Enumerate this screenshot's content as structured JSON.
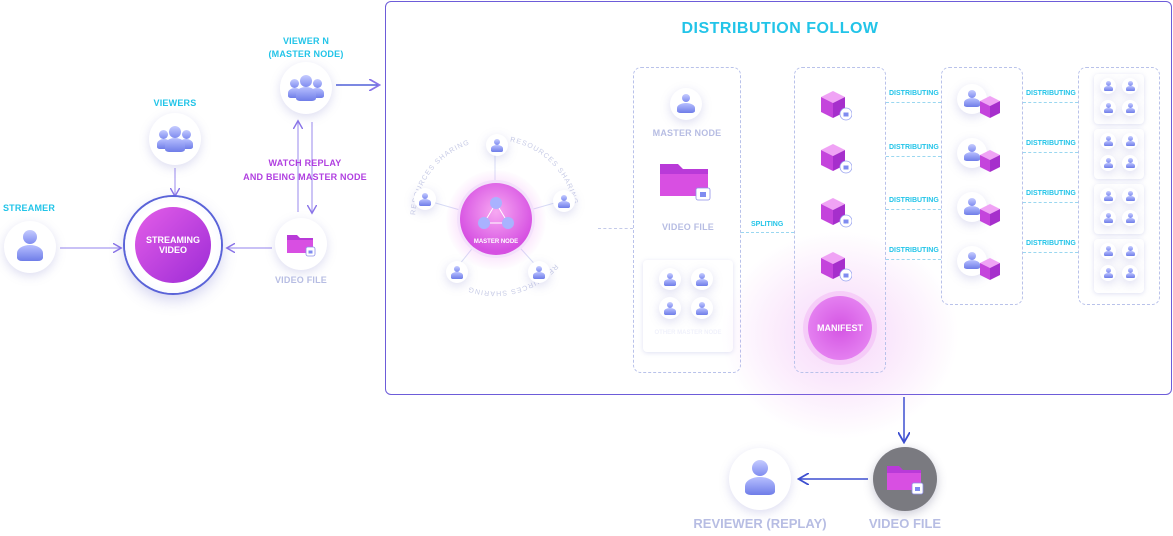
{
  "title": "DISTRIBUTION FOLLOW",
  "labels": {
    "streamer": "STREAMER",
    "viewers": "VIEWERS",
    "viewer_n_line1": "VIEWER N",
    "viewer_n_line2": "(MASTER NODE)",
    "watch_replay_line1": "WATCH REPLAY",
    "watch_replay_line2": "AND BEING MASTER NODE",
    "streaming_line1": "STREAMING",
    "streaming_line2": "VIDEO",
    "video_file": "VIDEO FILE",
    "master_node": "MASTER NODE",
    "master_node_center": "MASTER NODE",
    "resources_sharing": "RESOURCES SHARING",
    "other_master_node": "OTHER MASTER NODE",
    "spliting": "SPLITING",
    "distributing": "DISTRIBUTING",
    "manifest": "MANIFEST",
    "reviewer": "REVIEWER (REPLAY)",
    "video_file_bottom": "VIDEO FILE"
  },
  "colors": {
    "accent_cyan": "#22c4e8",
    "accent_purple": "#b03fe0",
    "frame_border": "#6d5cd9",
    "magenta": "#d23fe0"
  },
  "icons": [
    "person-icon",
    "group-icon",
    "folder-icon",
    "cube-icon",
    "lock-icon"
  ]
}
